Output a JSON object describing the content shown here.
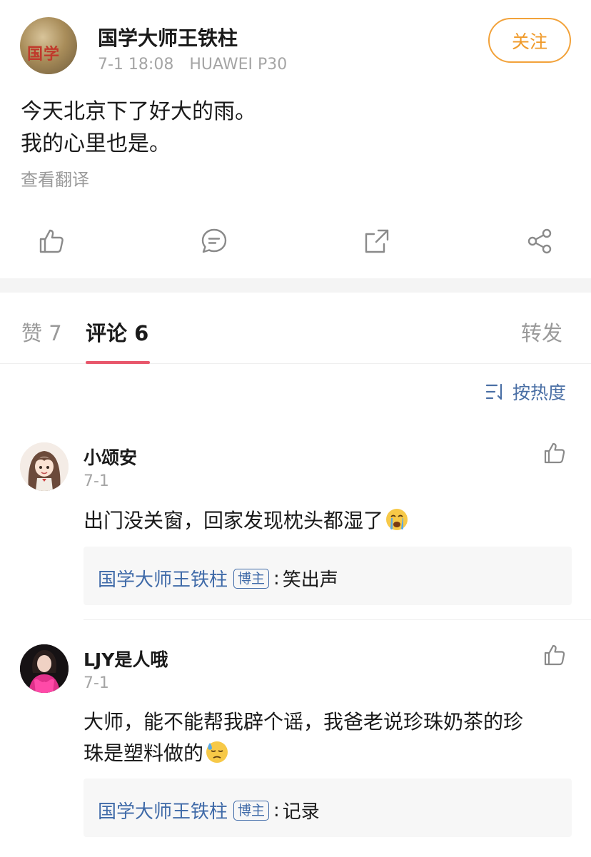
{
  "post": {
    "author": "国学大师王铁柱",
    "avatar_seal": "国学",
    "date": "7-1 18:08",
    "device": "HUAWEI P30",
    "follow_label": "关注",
    "text_line1": "今天北京下了好大的雨。",
    "text_line2": "我的心里也是。",
    "translate_label": "查看翻译"
  },
  "actions": [
    "thumbs-up-icon",
    "comment-icon",
    "repost-icon",
    "share-icon"
  ],
  "tabs": {
    "likes": "赞 7",
    "comments": "评论 6",
    "reposts": "转发"
  },
  "sort_label": "按热度",
  "comments": [
    {
      "name": "小颂安",
      "date": "7-1",
      "text": "出门没关窗，回家发现枕头都湿了",
      "emoji": "crying-face-emoji",
      "reply": {
        "author": "国学大师王铁柱",
        "badge": "博主",
        "colon": ":",
        "text": "笑出声"
      }
    },
    {
      "name": "LJY是人哦",
      "date": "7-1",
      "text_line1": "大师，能不能帮我辟个谣，我爸老说珍珠奶茶的珍",
      "text_line2": "珠是塑料做的",
      "emoji": "sweat-face-emoji",
      "reply": {
        "author": "国学大师王铁柱",
        "badge": "博主",
        "colon": ":",
        "text": "记录"
      }
    }
  ],
  "colors": {
    "accent_orange": "#f09a2a",
    "tab_underline": "#e8566b",
    "link_blue": "#3f6aa8",
    "muted": "#a5a5a5"
  }
}
